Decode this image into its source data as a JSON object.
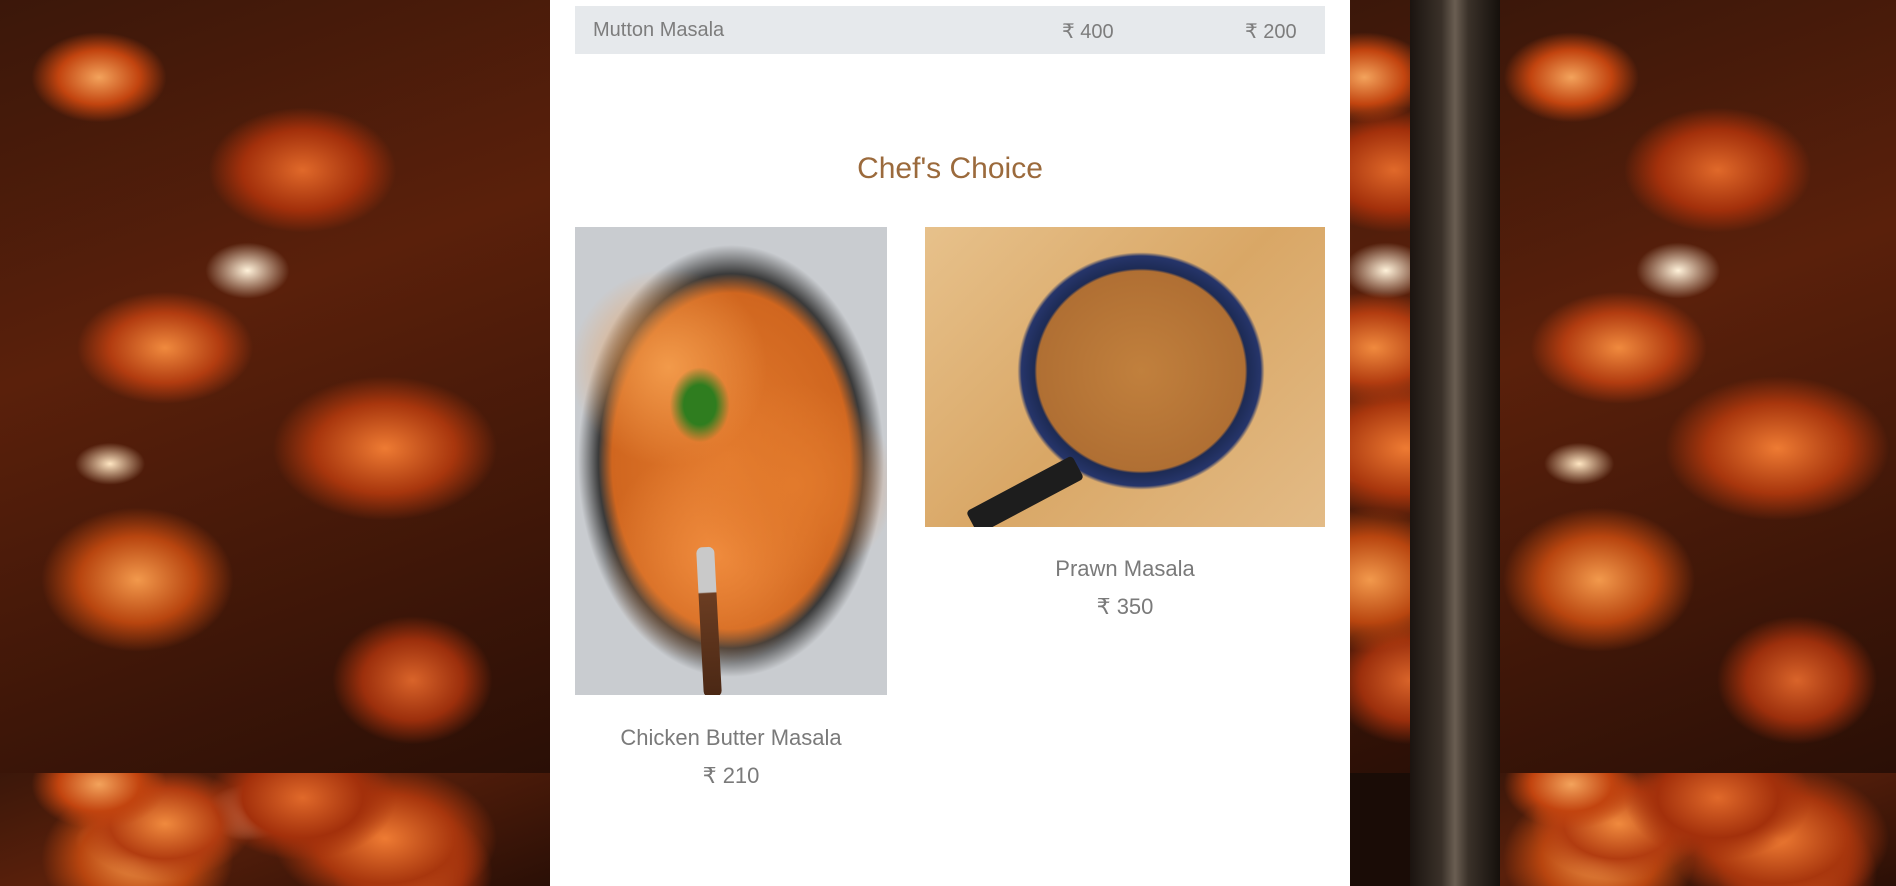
{
  "menu_row": {
    "name": "Mutton Masala",
    "price_full": "₹ 400",
    "price_half": "₹ 200"
  },
  "section": {
    "title": "Chef's Choice"
  },
  "dishes": [
    {
      "name": "Chicken Butter Masala",
      "price": "₹ 210"
    },
    {
      "name": "Prawn Masala",
      "price": "₹ 350"
    }
  ]
}
